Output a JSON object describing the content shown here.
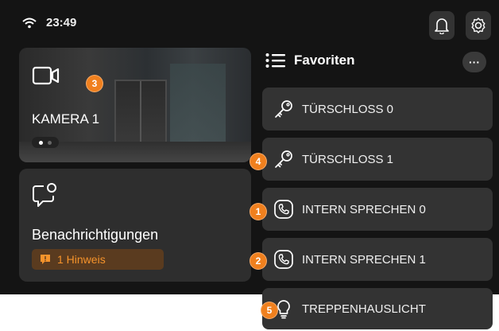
{
  "status": {
    "time": "23:49",
    "wifi_icon": "wifi-icon"
  },
  "topbar": {
    "bell_icon": "bell-icon",
    "settings_icon": "gear-icon"
  },
  "camera": {
    "label": "KAMERA 1",
    "badge": "3",
    "page_dots": 2,
    "active_dot": 0
  },
  "notifications": {
    "title": "Benachrichtigungen",
    "badge_text": "1 Hinweis"
  },
  "favorites": {
    "title": "Favoriten",
    "more": "···",
    "items": [
      {
        "label": "TÜRSCHLOSS 0",
        "icon": "key-icon",
        "badge": ""
      },
      {
        "label": "TÜRSCHLOSS 1",
        "icon": "key-icon",
        "badge": "4"
      },
      {
        "label": "INTERN SPRECHEN 0",
        "icon": "phone-icon",
        "badge": "1"
      },
      {
        "label": "INTERN SPRECHEN 1",
        "icon": "phone-icon",
        "badge": "2"
      },
      {
        "label": "TREPPENHAUSLICHT",
        "icon": "lightbulb-icon",
        "badge": "5"
      }
    ]
  },
  "colors": {
    "accent": "#f0801e",
    "panel": "#2e2e2e",
    "background": "#141414",
    "warning_text": "#f5932b"
  }
}
